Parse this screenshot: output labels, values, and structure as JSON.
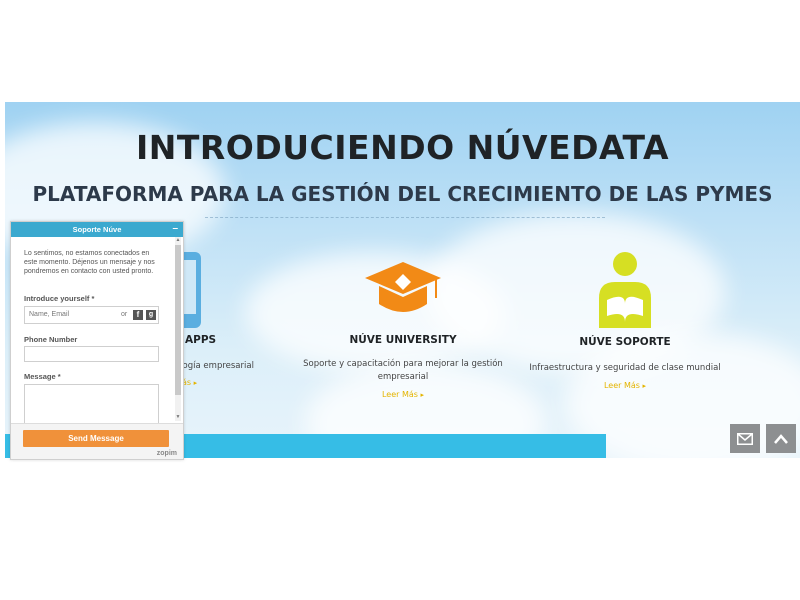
{
  "hero": {
    "title": "INTRODUCIENDO NÚVEDATA",
    "subtitle": "PLATAFORMA PARA LA GESTIÓN DEL CRECIMIENTO DE LAS PYMES"
  },
  "features": [
    {
      "title": "APPS",
      "desc_lines": [
        "ología empresarial"
      ],
      "link": "ás",
      "icon": "phone-icon",
      "color": "#5aaee0"
    },
    {
      "title": "NÚVE UNIVERSITY",
      "desc_lines": [
        "Soporte y capacitación para mejorar la gestión",
        "empresarial"
      ],
      "link": "Leer Más",
      "icon": "graduation-cap-icon",
      "color": "#f28a16"
    },
    {
      "title": "NÚVE SOPORTE",
      "desc_lines": [
        "Infraestructura y seguridad de clase mundial"
      ],
      "link": "Leer Más",
      "icon": "person-reading-icon",
      "color": "#d6df23"
    }
  ],
  "chat": {
    "title": "Soporte Núve",
    "minimize": "–",
    "offline_message": "Lo sentimos, no estamos conectados en este momento. Déjenos un mensaje y nos pondremos en contacto con usted pronto.",
    "introduce_label": "Introduce yourself *",
    "name_placeholder": "Name, Email",
    "or_text": "or",
    "phone_label": "Phone Number",
    "message_label": "Message *",
    "send_label": "Send Message",
    "branding": "zopim"
  },
  "colors": {
    "accent_orange": "#f0913a",
    "chat_header": "#3ba9cf",
    "link_yellow": "#e4b400",
    "blue_bar": "#36bde6"
  }
}
